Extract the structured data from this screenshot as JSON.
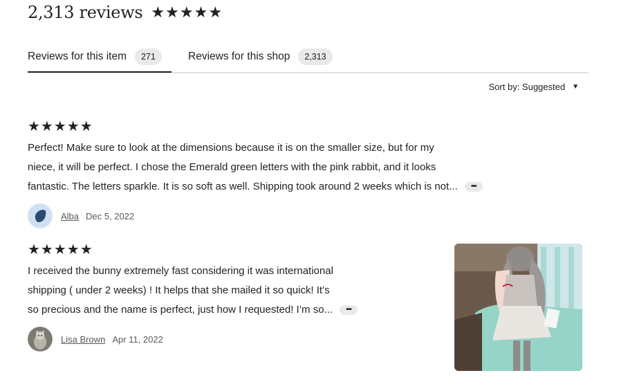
{
  "header": {
    "title": "2,313 reviews",
    "stars": "★★★★★"
  },
  "tabs": [
    {
      "label": "Reviews for this item",
      "count": "271"
    },
    {
      "label": "Reviews for this shop",
      "count": "2,313"
    }
  ],
  "sort": {
    "label": "Sort by: Suggested",
    "caret": "▼"
  },
  "reviews": [
    {
      "rating": 5,
      "stars": "★★★★★",
      "text_lines": [
        "Perfect! Make sure to look at the dimensions because it is on the smaller size, but for my",
        "niece, it will be perfect. I chose the Emerald green letters with the pink rabbit, and it looks",
        "fantastic. The letters sparkle. It is so soft as well. Shipping took around 2 weeks which is not..."
      ],
      "more": "•••",
      "author": "Alba",
      "date": "Dec 5, 2022"
    },
    {
      "rating": 5,
      "stars": "★★★★★",
      "text_lines": [
        "I received the bunny extremely fast considering it was international",
        "shipping ( under 2 weeks) ! It helps that she mailed it so quick! It’s",
        "so precious and the name is perfect, just how I requested! I’m so..."
      ],
      "more": "•••",
      "author": "Lisa Brown",
      "date": "Apr 11, 2022"
    }
  ],
  "colors": {
    "text": "#222222",
    "muted": "#595959",
    "badge_bg": "#e9e9e9",
    "divider": "#e1e1e1"
  }
}
